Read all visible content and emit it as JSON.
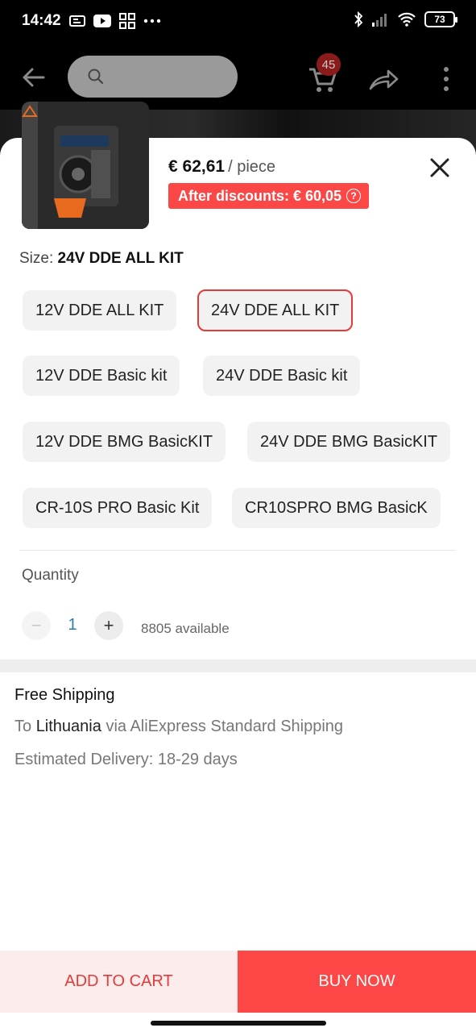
{
  "status_bar": {
    "time": "14:42",
    "battery": "73",
    "icons": [
      "notification-icon",
      "youtube-icon",
      "apps-icon",
      "more-dots-icon",
      "bluetooth-icon",
      "signal-icon",
      "wifi-icon",
      "battery-icon"
    ]
  },
  "toolbar": {
    "cart_count": "45",
    "icons": [
      "back-arrow-icon",
      "search-icon",
      "cart-icon",
      "share-icon",
      "more-vertical-icon"
    ]
  },
  "product": {
    "price": "€ 62,61",
    "unit": "/ piece",
    "discount_label": "After discounts: € 60,05",
    "help_glyph": "?"
  },
  "size": {
    "label": "Size:",
    "selected": "24V DDE ALL KIT",
    "options": [
      "12V DDE ALL KIT",
      "24V DDE ALL KIT",
      "12V DDE Basic kit",
      "24V DDE Basic kit",
      "12V DDE BMG BasicKIT",
      "24V DDE BMG BasicKIT",
      "CR-10S PRO Basic Kit",
      "CR10SPRO BMG BasicK"
    ]
  },
  "quantity": {
    "label": "Quantity",
    "minus": "−",
    "value": "1",
    "plus": "+",
    "available": "8805 available"
  },
  "shipping": {
    "title": "Free Shipping",
    "to_prefix": "To",
    "country": "Lithuania",
    "via": "via AliExpress Standard Shipping",
    "estimated": "Estimated Delivery: 18-29 days"
  },
  "actions": {
    "add_to_cart": "ADD TO CART",
    "buy_now": "BUY NOW"
  },
  "colors": {
    "accent": "#fd4646",
    "selected_border": "#e53a3a",
    "quantity_value": "#2a7fa3"
  }
}
